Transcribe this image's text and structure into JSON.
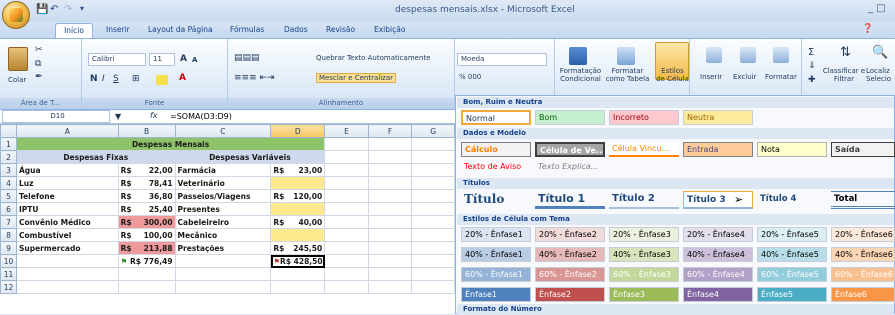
{
  "window": {
    "title": "despesas mensais.xlsx - Microsoft Excel"
  },
  "tabs": [
    "Início",
    "Inserir",
    "Layout da Página",
    "Fórmulas",
    "Dados",
    "Revisão",
    "Exibição"
  ],
  "ribbon": {
    "clipboard": {
      "paste": "Colar",
      "label": "Área de T..."
    },
    "font": {
      "name": "Calibri",
      "size": "11",
      "grow": "A",
      "shrink": "A",
      "bold": "N",
      "italic": "I",
      "underline": "S",
      "label": "Fonte"
    },
    "alignment": {
      "wrap": "Quebrar Texto Automaticamente",
      "merge": "Mesclar e Centralizar",
      "label": "Alinhamento"
    },
    "number": {
      "format": "Moeda",
      "currency": "% 000"
    },
    "styles": {
      "conditional": "Formatação Condicional",
      "astable": "Formatar como Tabela",
      "cellstyles": "Estilos de Célula"
    },
    "cells": {
      "insert": "Inserir",
      "delete": "Excluir",
      "format": "Formatar"
    },
    "editing": {
      "sort": "Classificar e Filtrar",
      "find": "Localiz Selecio"
    }
  },
  "formula_bar": {
    "name_box": "D10",
    "fx": "fx",
    "formula": "=SOMA(D3:D9)"
  },
  "columns": [
    "A",
    "B",
    "C",
    "D",
    "E",
    "F",
    "G"
  ],
  "rows": [
    "1",
    "2",
    "3",
    "4",
    "5",
    "6",
    "7",
    "8",
    "9",
    "10",
    "11",
    "12"
  ],
  "sheet": {
    "title": "Despesas Mensais",
    "fixed_header": "Despesas Fixas",
    "variable_header": "Despesas Variáveis",
    "fixed": [
      {
        "item": "Água",
        "cur": "R$",
        "val": "22,00"
      },
      {
        "item": "Luz",
        "cur": "R$",
        "val": "78,41"
      },
      {
        "item": "Telefone",
        "cur": "R$",
        "val": "36,80"
      },
      {
        "item": "IPTU",
        "cur": "R$",
        "val": "25,40"
      },
      {
        "item": "Convênio Médico",
        "cur": "R$",
        "val": "300,00"
      },
      {
        "item": "Combustível",
        "cur": "R$",
        "val": "100,00"
      },
      {
        "item": "Supermercado",
        "cur": "R$",
        "val": "213,88"
      }
    ],
    "variable": [
      {
        "item": "Farmácia",
        "cur": "R$",
        "val": "23,00"
      },
      {
        "item": "Veterinário",
        "cur": "",
        "val": ""
      },
      {
        "item": "Passeios/Viagens",
        "cur": "R$",
        "val": "120,00"
      },
      {
        "item": "Presentes",
        "cur": "",
        "val": ""
      },
      {
        "item": "Cabeleireiro",
        "cur": "R$",
        "val": "40,00"
      },
      {
        "item": "Mecânico",
        "cur": "",
        "val": ""
      },
      {
        "item": "Prestações",
        "cur": "R$",
        "val": "245,50"
      }
    ],
    "total_fixed": "R$ 776,49",
    "total_variable": "R$ 428,50"
  },
  "gallery": {
    "good_bad": {
      "header": "Bom, Ruim e Neutra",
      "items": [
        "Normal",
        "Bom",
        "Incorreto",
        "Neutra"
      ]
    },
    "data_model": {
      "header": "Dados e Modelo",
      "items": [
        "Cálculo",
        "Célula de Ve...",
        "Célula Vincu...",
        "Entrada",
        "Nota",
        "Saída"
      ],
      "items2": [
        "Texto de Aviso",
        "Texto Explica..."
      ]
    },
    "titles": {
      "header": "Títulos",
      "items": [
        "Título",
        "Título 1",
        "Título 2",
        "Título 3",
        "Título 4",
        "Total"
      ]
    },
    "themed": {
      "header": "Estilos de Célula com Tema",
      "row20": [
        "20% - Ênfase1",
        "20% - Ênfase2",
        "20% - Ênfase3",
        "20% - Ênfase4",
        "20% - Ênfase5",
        "20% - Ênfase6"
      ],
      "row40": [
        "40% - Ênfase1",
        "40% - Ênfase2",
        "40% - Ênfase3",
        "40% - Ênfase4",
        "40% - Ênfase5",
        "40% - Ênfase6"
      ],
      "row60": [
        "60% - Ênfase1",
        "60% - Ênfase2",
        "60% - Ênfase3",
        "60% - Ênfase4",
        "60% - Ênfase5",
        "60% - Ênfase6"
      ],
      "row100": [
        "Ênfase1",
        "Ênfase2",
        "Ênfase3",
        "Ênfase4",
        "Ênfase5",
        "Ênfase6"
      ]
    },
    "number_format": {
      "header": "Formato do Número"
    }
  }
}
